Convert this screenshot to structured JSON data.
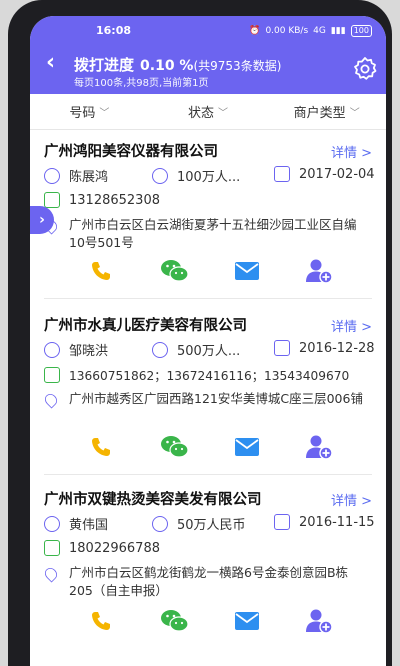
{
  "status_bar": {
    "time": "16:08",
    "net": "0.00 KB/s",
    "signal": "4G",
    "battery": "100"
  },
  "header": {
    "back": "‹",
    "title": "拨打进度",
    "percent": "0.10 %",
    "count": "(共9753条数据)",
    "subtitle": "每页100条,共98页,当前第1页",
    "settings_icon": "gear-icon"
  },
  "filters": [
    {
      "label": "号码"
    },
    {
      "label": "状态"
    },
    {
      "label": "商户类型"
    }
  ],
  "detail_label": "详情 >",
  "records": [
    {
      "company": "广州鸿阳美容仪器有限公司",
      "contact": "陈展鸿",
      "capital": "100万人...",
      "date": "2017-02-04",
      "phones": "13128652308",
      "address": "广州市白云区白云湖街夏茅十五社细沙园工业区自编10号501号"
    },
    {
      "company": "广州市水真儿医疗美容有限公司",
      "contact": "邹晓洪",
      "capital": "500万人...",
      "date": "2016-12-28",
      "phones": "13660751862；13672416116；13543409670",
      "address": "广州市越秀区广园西路121安华美博城C座三层006铺"
    },
    {
      "company": "广州市双键热烫美容美发有限公司",
      "contact": "黄伟国",
      "capital": "50万人民币",
      "date": "2016-11-15",
      "phones": "18022966788",
      "address": "广州市白云区鹤龙街鹤龙一横路6号金泰创意园B栋205（自主申报）"
    }
  ],
  "colors": {
    "accent": "#6c64f0",
    "phone": "#f5b400",
    "wechat": "#3ab54a",
    "mail": "#2d8ff0"
  }
}
